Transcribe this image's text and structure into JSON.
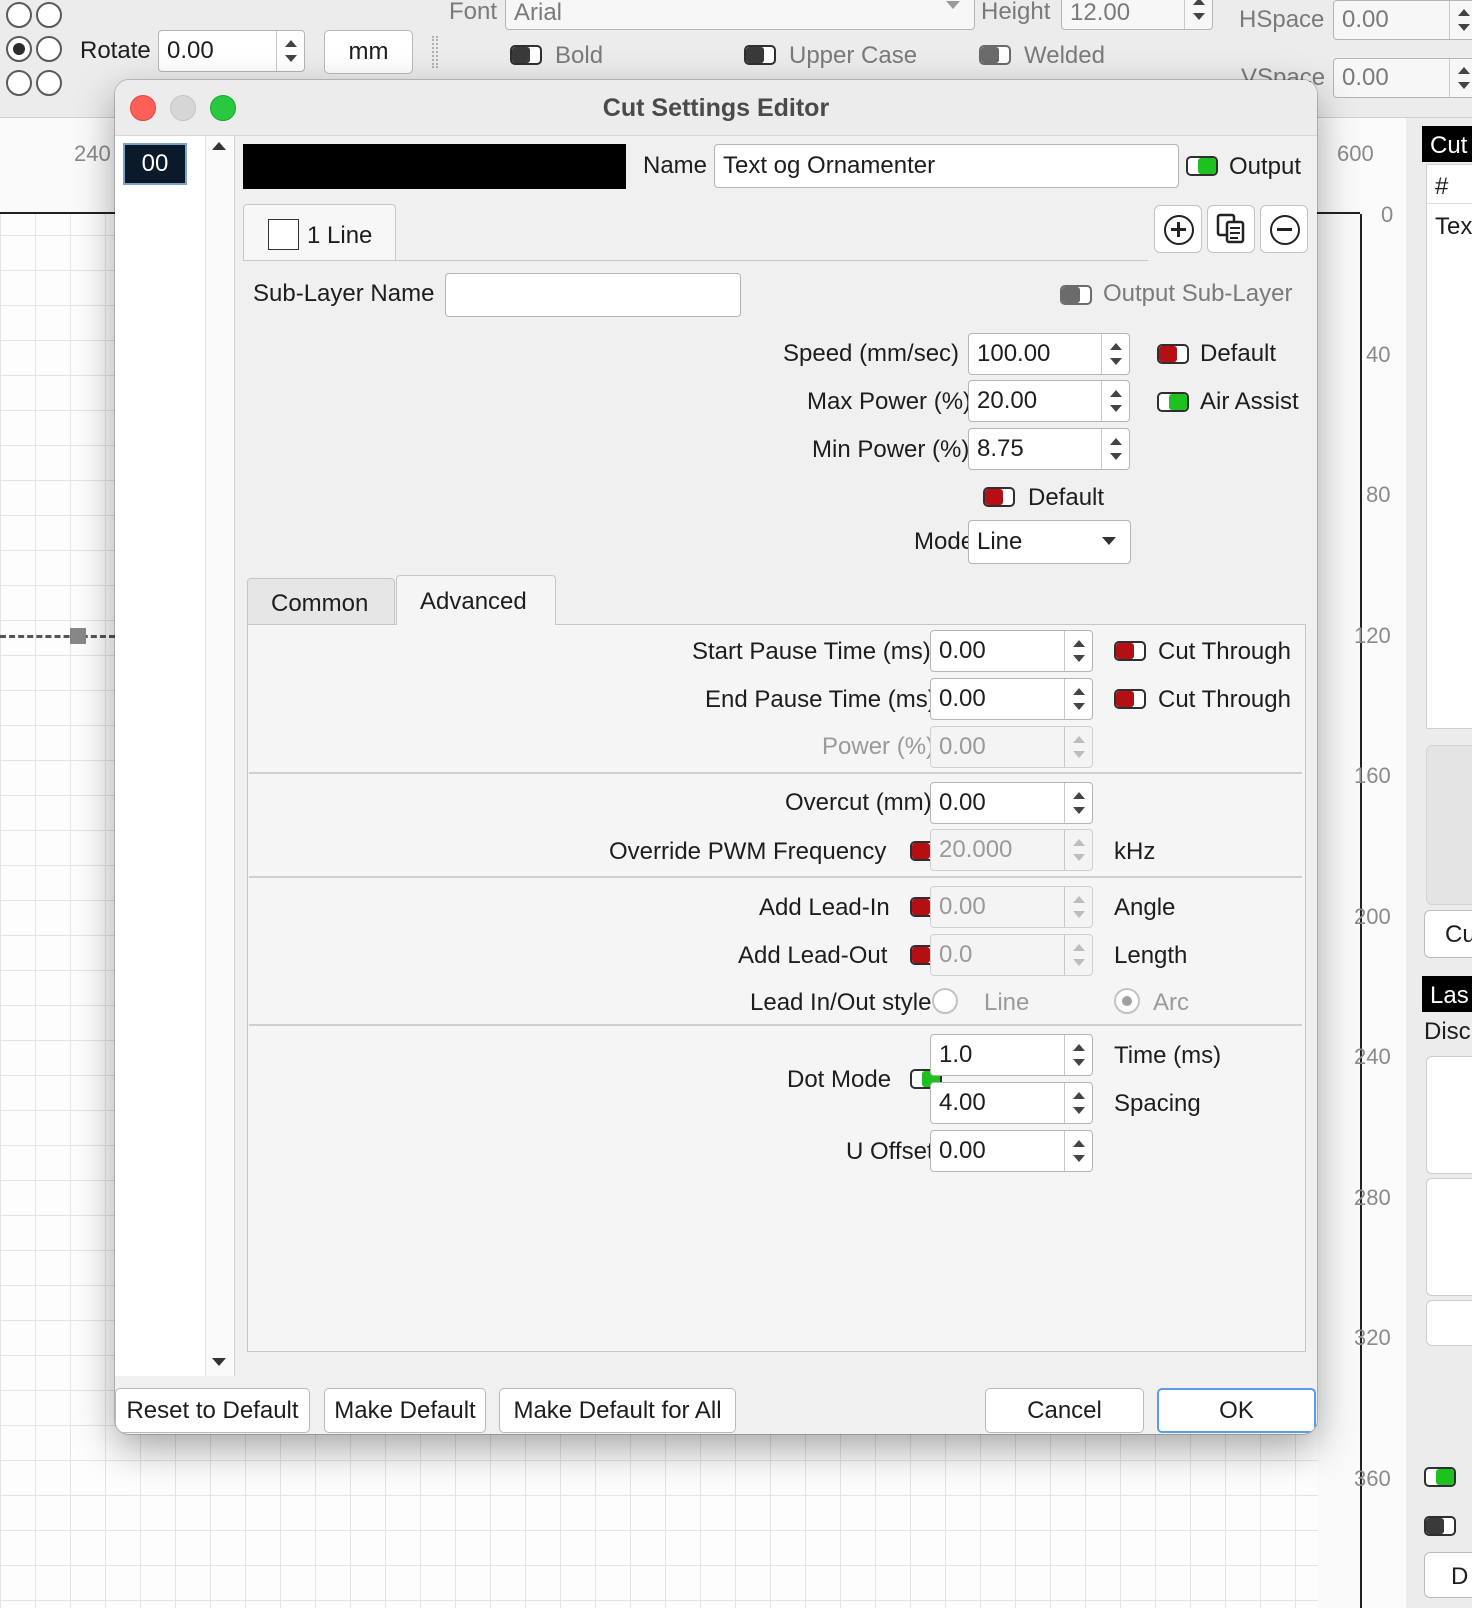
{
  "toolbar": {
    "rotate_label": "Rotate",
    "rotate_value": "0.00",
    "unit_button": "mm",
    "font_label": "Font",
    "font_value": "Arial",
    "height_label": "Height",
    "height_value": "12.00",
    "hspace_label": "HSpace",
    "hspace_value": "0.00",
    "vspace_label": "VSpace",
    "vspace_value": "0.00",
    "bold_label": "Bold",
    "upper_case_label": "Upper Case",
    "welded_label": "Welded"
  },
  "ruler": {
    "top_left": "240",
    "top_right": "600",
    "right_numbers": [
      "0",
      "40",
      "80",
      "120",
      "160",
      "200",
      "240",
      "280",
      "320",
      "360"
    ]
  },
  "right_panel": {
    "cuts_header": "Cut",
    "col_hash": "#",
    "row_text": "Tex",
    "cu_button": "Cu",
    "laser_header": "Las",
    "disc_text": "Disc",
    "d_button": "D"
  },
  "dialog": {
    "title": "Cut Settings Editor",
    "layer_list": [
      "00"
    ],
    "layer_color": "#000000",
    "name_label": "Name",
    "name_value": "Text og Ornamenter",
    "output_label": "Output",
    "sub_layer_tab": "1 Line",
    "sub_layer_name_label": "Sub-Layer Name",
    "sub_layer_name_value": "",
    "output_sub_layer_label": "Output Sub-Layer",
    "speed_label": "Speed (mm/sec)",
    "speed_value": "100.00",
    "speed_default_label": "Default",
    "max_power_label": "Max Power (%)",
    "max_power_value": "20.00",
    "air_assist_label": "Air Assist",
    "min_power_label": "Min Power (%)",
    "min_power_value": "8.75",
    "power_default_label": "Default",
    "mode_label": "Mode",
    "mode_value": "Line",
    "tabs": [
      "Common",
      "Advanced"
    ],
    "active_tab": "Advanced",
    "advanced": {
      "start_pause_label": "Start Pause Time (ms)",
      "start_pause_value": "0.00",
      "start_cut_through": "Cut Through",
      "end_pause_label": "End Pause Time (ms)",
      "end_pause_value": "0.00",
      "end_cut_through": "Cut Through",
      "power_label": "Power (%)",
      "power_value": "0.00",
      "overcut_label": "Overcut (mm)",
      "overcut_value": "0.00",
      "pwm_label": "Override PWM Frequency",
      "pwm_value": "20.000",
      "pwm_unit": "kHz",
      "lead_in_label": "Add Lead-In",
      "lead_in_value": "0.00",
      "lead_in_unit": "Angle",
      "lead_out_label": "Add Lead-Out",
      "lead_out_value": "0.0",
      "lead_out_unit": "Length",
      "lead_style_label": "Lead In/Out style",
      "lead_style_line": "Line",
      "lead_style_arc": "Arc",
      "dot_mode_label": "Dot Mode",
      "dot_time_value": "1.0",
      "dot_time_unit": "Time (ms)",
      "dot_spacing_value": "4.00",
      "dot_spacing_unit": "Spacing",
      "u_offset_label": "U Offset",
      "u_offset_value": "0.00"
    },
    "buttons": {
      "reset": "Reset to Default",
      "make_default": "Make Default",
      "make_default_all": "Make Default for All",
      "cancel": "Cancel",
      "ok": "OK"
    }
  },
  "colors": {
    "toggle_on": "#1ec21e",
    "toggle_off": "#b40f12",
    "ok_border": "#5b9bea",
    "close": "#fe5f57",
    "minimize": "#d6d6d6",
    "zoom": "#28c840"
  }
}
